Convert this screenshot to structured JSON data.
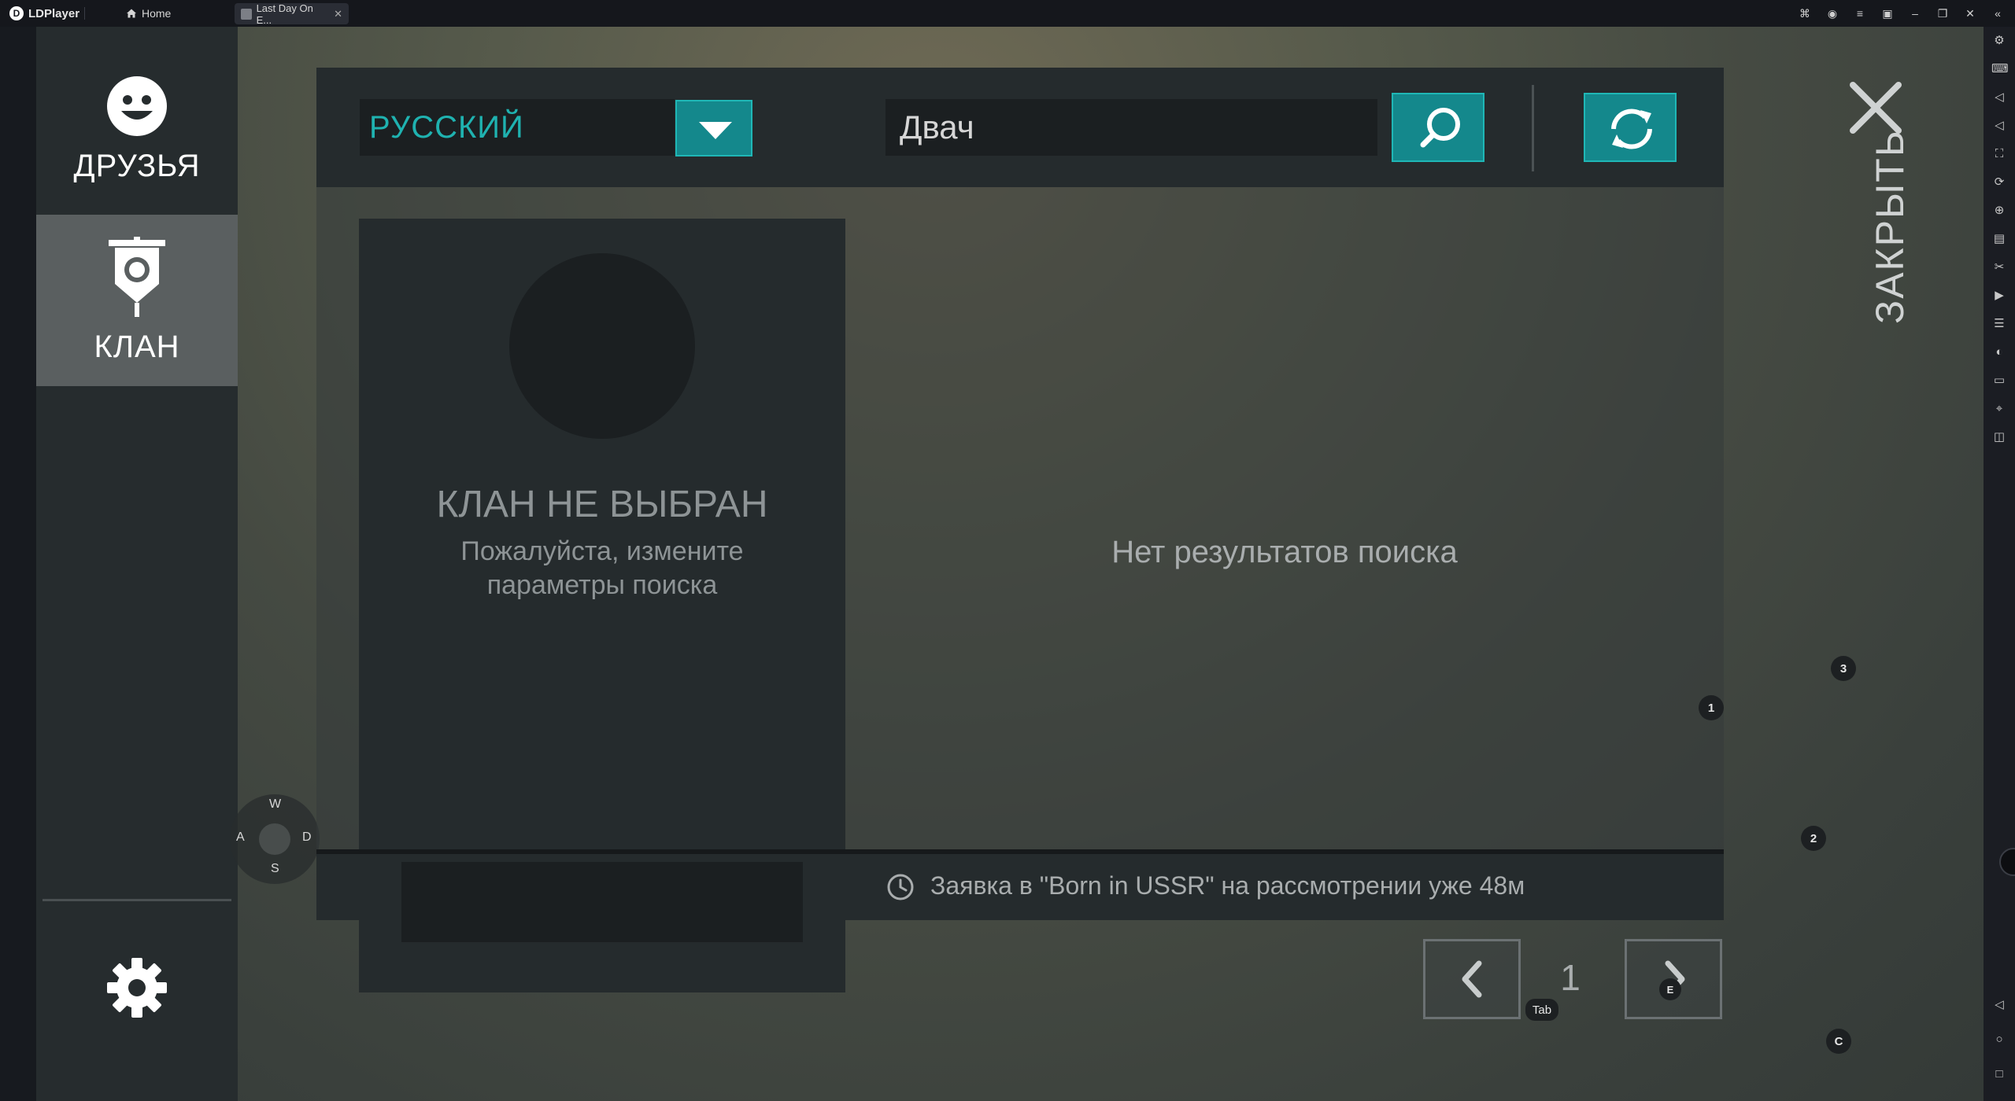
{
  "titlebar": {
    "app_name": "LDPlayer",
    "tabs": [
      {
        "label": "Home"
      },
      {
        "label": "Last Day On E..."
      }
    ]
  },
  "menu": {
    "friends_label": "ДРУЗЬЯ",
    "clan_label": "КЛАН"
  },
  "wasd": {
    "up": "W",
    "left": "A",
    "right": "D",
    "down": "S"
  },
  "search": {
    "language_value": "РУССКИЙ",
    "query_value": "Двач"
  },
  "clan_card": {
    "title": "КЛАН НЕ ВЫБРАН",
    "subtitle_line1": "Пожалуйста, измените",
    "subtitle_line2": "параметры поиска"
  },
  "results": {
    "empty_text": "Нет результатов поиска",
    "status_text": "Заявка в \"Born in USSR\" на рассмотрении уже 48м"
  },
  "pager": {
    "page": "1"
  },
  "close": {
    "label": "ЗАКРЫТЬ"
  },
  "hints": {
    "h3": "3",
    "h1": "1",
    "h2": "2",
    "hE": "E",
    "hC": "C",
    "hTab": "Tab"
  },
  "colors": {
    "accent": "#1fb2b0",
    "button_fill": "#14888c",
    "panel": "#252b2d"
  }
}
